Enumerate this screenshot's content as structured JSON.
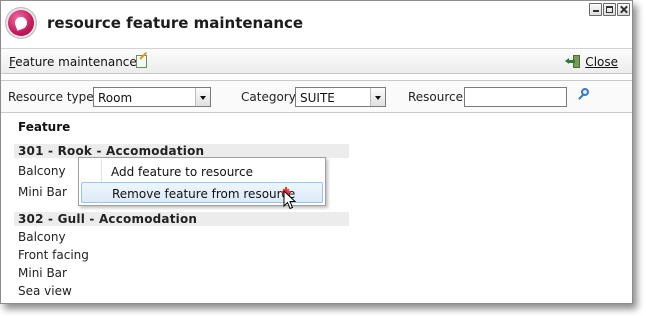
{
  "window": {
    "title": "resource feature maintenance",
    "buttons": [
      "minimize",
      "maximize",
      "close"
    ]
  },
  "toolbar": {
    "title_first_letter": "F",
    "title_rest": "eature maintenance",
    "edit_icon": "edit-icon",
    "close_first_letter": "C",
    "close_rest": "lose",
    "close_icon": "exit-door-icon"
  },
  "filters": {
    "resource_type": {
      "label": "Resource type",
      "value": "Room"
    },
    "category": {
      "label": "Category",
      "value": "SUITE"
    },
    "resource": {
      "label": "Resource",
      "value": ""
    },
    "search_icon": "search-icon"
  },
  "content": {
    "heading": "Feature",
    "groups": [
      {
        "title": "301 - Rook - Accomodation",
        "items": [
          "Balcony",
          "Mini Bar"
        ]
      },
      {
        "title": "302 - Gull - Accomodation",
        "items": [
          "Balcony",
          "Front facing",
          "Mini Bar",
          "Sea view"
        ]
      }
    ]
  },
  "context_menu": {
    "items": [
      {
        "label": "Add feature to resource",
        "highlighted": false
      },
      {
        "label": "Remove feature from resource",
        "highlighted": true
      }
    ],
    "marker_icon": "red-star-icon"
  },
  "colors": {
    "logo": "#c2185b",
    "menu_highlight": "#dbeaf7",
    "group_header_bg": "#ececec"
  }
}
